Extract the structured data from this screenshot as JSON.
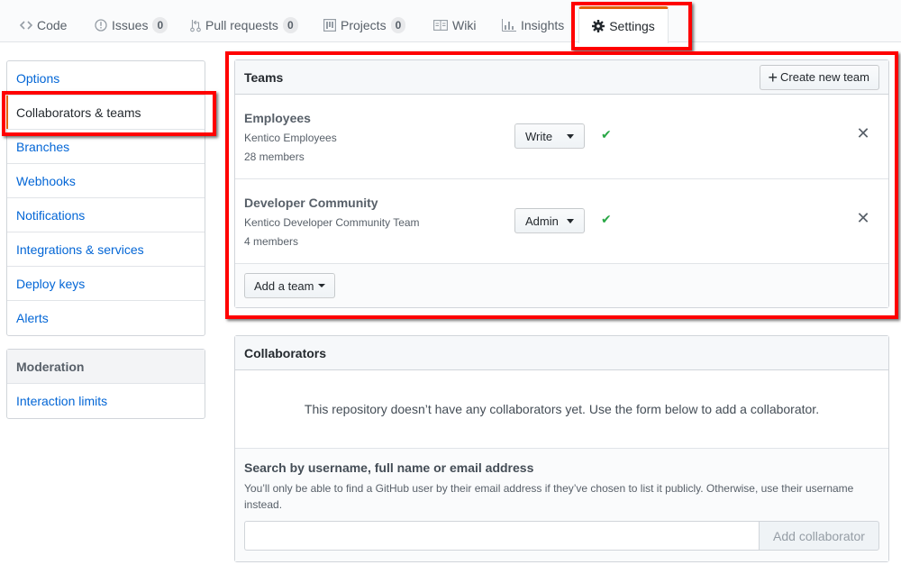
{
  "reponav": {
    "items": [
      {
        "label": "Code",
        "icon": "code-icon"
      },
      {
        "label": "Issues",
        "icon": "issue-icon",
        "count": "0"
      },
      {
        "label": "Pull requests",
        "icon": "pull-request-icon",
        "count": "0"
      },
      {
        "label": "Projects",
        "icon": "project-icon",
        "count": "0"
      },
      {
        "label": "Wiki",
        "icon": "book-icon"
      },
      {
        "label": "Insights",
        "icon": "graph-icon"
      }
    ],
    "selected": {
      "label": "Settings",
      "icon": "gear-icon"
    }
  },
  "sidebar": {
    "items": [
      {
        "label": "Options"
      },
      {
        "label": "Collaborators & teams",
        "selected": true
      },
      {
        "label": "Branches"
      },
      {
        "label": "Webhooks"
      },
      {
        "label": "Notifications"
      },
      {
        "label": "Integrations & services"
      },
      {
        "label": "Deploy keys"
      },
      {
        "label": "Alerts"
      }
    ],
    "moderation": {
      "heading": "Moderation",
      "items": [
        {
          "label": "Interaction limits"
        }
      ]
    }
  },
  "teams": {
    "title": "Teams",
    "create_button": "Create new team",
    "rows": [
      {
        "name": "Employees",
        "description": "Kentico Employees",
        "members": "28 members",
        "permission": "Write"
      },
      {
        "name": "Developer Community",
        "description": "Kentico Developer Community Team",
        "members": "4 members",
        "permission": "Admin"
      }
    ],
    "add_button": "Add a team"
  },
  "collaborators": {
    "title": "Collaborators",
    "empty_message": "This repository doesn’t have any collaborators yet. Use the form below to add a collaborator.",
    "search_label": "Search by username, full name or email address",
    "search_note": "You’ll only be able to find a GitHub user by their email address if they’ve chosen to list it publicly. Otherwise, use their username instead.",
    "search_value": "",
    "add_button": "Add collaborator"
  },
  "colors": {
    "accent_link": "#0366d6",
    "selected_indicator": "#e36209",
    "success_check": "#28a745",
    "annotation_red": "#ff0000"
  }
}
